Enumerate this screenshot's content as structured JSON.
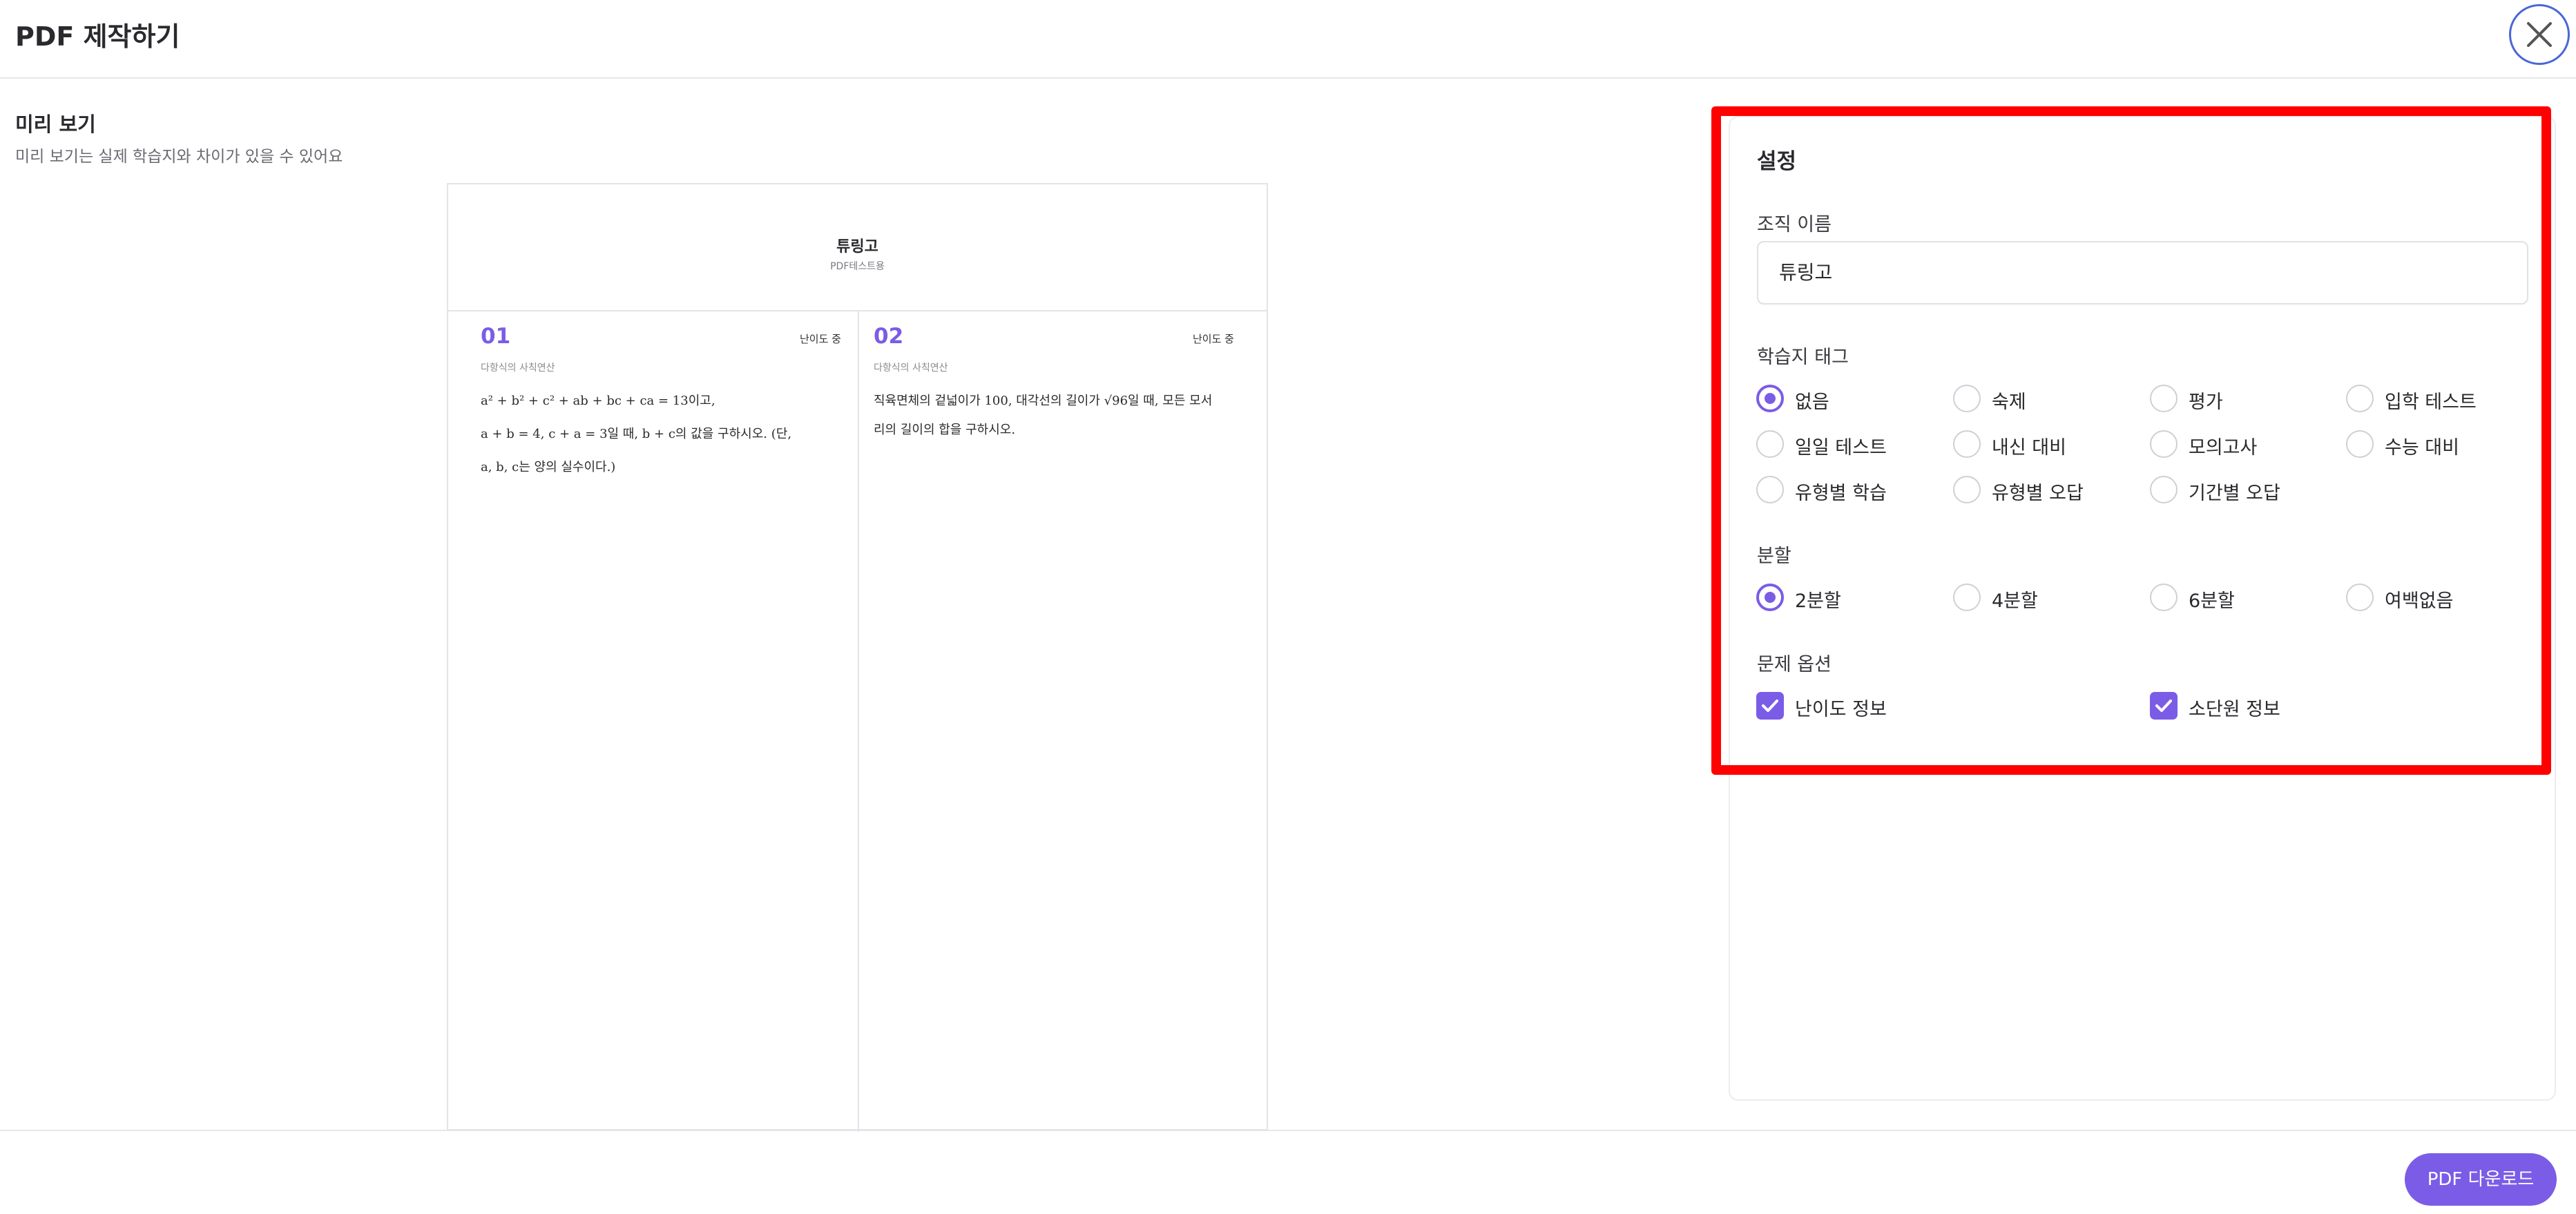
{
  "header": {
    "title": "PDF 제작하기",
    "close_icon": "close-icon"
  },
  "preview": {
    "title": "미리 보기",
    "subtitle": "미리 보기는 실제 학습지와 차이가 있을 수 있어요",
    "sheet": {
      "org_name": "튜링고",
      "sub": "PDF테스트용",
      "questions": [
        {
          "number": "01",
          "difficulty": "난이도 중",
          "category": "다항식의 사칙연산",
          "lines": [
            "a² + b² + c² + ab + bc + ca = 13이고,",
            "a + b = 4,  c + a = 3일 때, b + c의 값을 구하시오. (단,",
            "a,  b,  c는 양의 실수이다.)"
          ]
        },
        {
          "number": "02",
          "difficulty": "난이도 중",
          "category": "다항식의 사칙연산",
          "lines": [
            "직육면체의 겉넓이가 100, 대각선의 길이가 √96일 때, 모든 모서",
            "리의 길이의 합을 구하시오."
          ]
        }
      ]
    }
  },
  "settings": {
    "title": "설정",
    "org_label": "조직 이름",
    "org_value": "튜링고",
    "tag_label": "학습지 태그",
    "tags": [
      {
        "label": "없음",
        "selected": true
      },
      {
        "label": "숙제",
        "selected": false
      },
      {
        "label": "평가",
        "selected": false
      },
      {
        "label": "입학 테스트",
        "selected": false
      },
      {
        "label": "일일 테스트",
        "selected": false
      },
      {
        "label": "내신 대비",
        "selected": false
      },
      {
        "label": "모의고사",
        "selected": false
      },
      {
        "label": "수능 대비",
        "selected": false
      },
      {
        "label": "유형별 학습",
        "selected": false
      },
      {
        "label": "유형별 오답",
        "selected": false
      },
      {
        "label": "기간별 오답",
        "selected": false
      }
    ],
    "split_label": "분할",
    "splits": [
      {
        "label": "2분할",
        "selected": true
      },
      {
        "label": "4분할",
        "selected": false
      },
      {
        "label": "6분할",
        "selected": false
      },
      {
        "label": "여백없음",
        "selected": false
      }
    ],
    "options_label": "문제 옵션",
    "options": [
      {
        "label": "난이도 정보",
        "checked": true
      },
      {
        "label": "소단원 정보",
        "checked": true
      }
    ]
  },
  "footer": {
    "download_label": "PDF 다운로드"
  },
  "colors": {
    "accent": "#7b5ce6",
    "highlight": "#ff0000",
    "close_border": "#4a66d9"
  }
}
